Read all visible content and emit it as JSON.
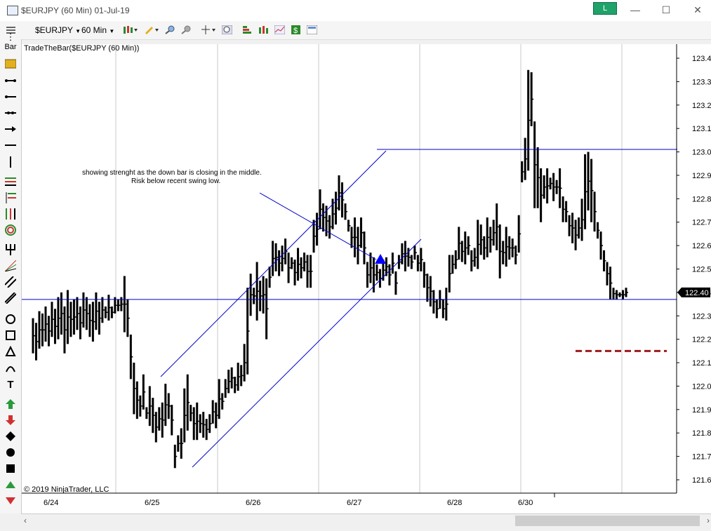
{
  "window": {
    "title": "$EURJPY (60 Min)  01-Jul-19",
    "badge": "L",
    "minimize": "—",
    "maximize": "☐",
    "close": "✕"
  },
  "toolbar": {
    "instrument": "$EURJPY",
    "interval": "60 Min"
  },
  "sidebar": {
    "bar_label": "Bar"
  },
  "chart": {
    "indicator_label": "TradeTheBar($EURJPY (60 Min))",
    "copyright": "© 2019 NinjaTrader, LLC",
    "annotation_line1": "showing strenght as the down bar is closing in the middle.",
    "annotation_line2": "Risk below recent swing low."
  },
  "chart_data": {
    "type": "ohlc",
    "y_ticks": [
      "123.40",
      "123.30",
      "123.20",
      "123.10",
      "123.00",
      "122.90",
      "122.80",
      "122.70",
      "122.60",
      "122.50",
      "122.40",
      "122.30",
      "122.20",
      "122.10",
      "122.00",
      "121.90",
      "121.80",
      "121.70",
      "121.60"
    ],
    "ylim": [
      121.57,
      123.46
    ],
    "x_labels": [
      "6/24",
      "6/25",
      "6/26",
      "6/27",
      "6/28",
      "6/30"
    ],
    "current_price": "122.40",
    "horizontal_lines": [
      122.37,
      123.18
    ],
    "dashed_level": 122.15,
    "colors": {
      "bars": "#000000",
      "lines": "#0000cc",
      "dashed": "#9b1c1c",
      "price_tag": "#000000"
    },
    "bars": [
      [
        122.29,
        122.14
      ],
      [
        122.27,
        122.11
      ],
      [
        122.32,
        122.16
      ],
      [
        122.31,
        122.17
      ],
      [
        122.34,
        122.19
      ],
      [
        122.3,
        122.17
      ],
      [
        122.36,
        122.21
      ],
      [
        122.33,
        122.18
      ],
      [
        122.38,
        122.2
      ],
      [
        122.4,
        122.22
      ],
      [
        122.34,
        122.14
      ],
      [
        122.41,
        122.18
      ],
      [
        122.36,
        122.21
      ],
      [
        122.37,
        122.22
      ],
      [
        122.38,
        122.24
      ],
      [
        122.34,
        122.2
      ],
      [
        122.4,
        122.25
      ],
      [
        122.38,
        122.24
      ],
      [
        122.35,
        122.21
      ],
      [
        122.36,
        122.19
      ],
      [
        122.4,
        122.24
      ],
      [
        122.36,
        122.22
      ],
      [
        122.38,
        122.27
      ],
      [
        122.34,
        122.29
      ],
      [
        122.39,
        122.28
      ],
      [
        122.34,
        122.29
      ],
      [
        122.38,
        122.31
      ],
      [
        122.37,
        122.32
      ],
      [
        122.38,
        122.32
      ],
      [
        122.47,
        122.23
      ],
      [
        122.37,
        122.21
      ],
      [
        122.22,
        122.03
      ],
      [
        122.1,
        121.88
      ],
      [
        122.02,
        121.86
      ],
      [
        121.96,
        121.87
      ],
      [
        122.05,
        121.9
      ],
      [
        121.91,
        121.86
      ],
      [
        122.0,
        121.83
      ],
      [
        121.95,
        121.8
      ],
      [
        121.89,
        121.76
      ],
      [
        121.91,
        121.81
      ],
      [
        121.93,
        121.78
      ],
      [
        122.01,
        121.83
      ],
      [
        121.97,
        121.86
      ],
      [
        121.92,
        121.79
      ],
      [
        121.75,
        121.65
      ],
      [
        121.79,
        121.72
      ],
      [
        121.82,
        121.69
      ],
      [
        121.99,
        121.76
      ],
      [
        122.05,
        121.81
      ],
      [
        121.92,
        121.85
      ],
      [
        121.91,
        121.77
      ],
      [
        121.93,
        121.77
      ],
      [
        121.88,
        121.8
      ],
      [
        121.89,
        121.78
      ],
      [
        121.86,
        121.77
      ],
      [
        121.88,
        121.8
      ],
      [
        121.94,
        121.84
      ],
      [
        121.93,
        121.82
      ],
      [
        122.03,
        121.86
      ],
      [
        121.97,
        121.9
      ],
      [
        122.03,
        121.95
      ],
      [
        122.07,
        121.97
      ],
      [
        122.08,
        121.99
      ],
      [
        122.04,
        121.97
      ],
      [
        122.1,
        121.98
      ],
      [
        122.09,
        122.0
      ],
      [
        122.18,
        122.02
      ],
      [
        122.42,
        122.05
      ],
      [
        122.48,
        122.3
      ],
      [
        122.42,
        122.35
      ],
      [
        122.53,
        122.28
      ],
      [
        122.45,
        122.32
      ],
      [
        122.47,
        122.31
      ],
      [
        122.46,
        122.2
      ],
      [
        122.51,
        122.42
      ],
      [
        122.62,
        122.47
      ],
      [
        122.61,
        122.49
      ],
      [
        122.58,
        122.47
      ],
      [
        122.6,
        122.49
      ],
      [
        122.63,
        122.52
      ],
      [
        122.57,
        122.44
      ],
      [
        122.55,
        122.5
      ],
      [
        122.54,
        122.43
      ],
      [
        122.59,
        122.45
      ],
      [
        122.55,
        122.46
      ],
      [
        122.57,
        122.49
      ],
      [
        122.56,
        122.42
      ],
      [
        122.56,
        122.42
      ],
      [
        122.71,
        122.57
      ],
      [
        122.74,
        122.6
      ],
      [
        122.84,
        122.67
      ],
      [
        122.78,
        122.66
      ],
      [
        122.77,
        122.64
      ],
      [
        122.73,
        122.63
      ],
      [
        122.8,
        122.67
      ],
      [
        122.83,
        122.69
      ],
      [
        122.9,
        122.75
      ],
      [
        122.87,
        122.72
      ],
      [
        122.78,
        122.71
      ],
      [
        122.71,
        122.66
      ],
      [
        122.68,
        122.59
      ],
      [
        122.72,
        122.55
      ],
      [
        122.68,
        122.52
      ],
      [
        122.72,
        122.59
      ],
      [
        122.66,
        122.52
      ],
      [
        122.53,
        122.42
      ],
      [
        122.57,
        122.44
      ],
      [
        122.55,
        122.4
      ],
      [
        122.52,
        122.45
      ],
      [
        122.5,
        122.42
      ],
      [
        122.54,
        122.45
      ],
      [
        122.55,
        122.47
      ],
      [
        122.52,
        122.43
      ],
      [
        122.57,
        122.48
      ],
      [
        122.49,
        122.39
      ],
      [
        122.56,
        122.5
      ],
      [
        122.61,
        122.52
      ],
      [
        122.62,
        122.49
      ],
      [
        122.59,
        122.51
      ],
      [
        122.56,
        122.5
      ],
      [
        122.6,
        122.54
      ],
      [
        122.56,
        122.49
      ],
      [
        122.59,
        122.49
      ],
      [
        122.53,
        122.42
      ],
      [
        122.48,
        122.36
      ],
      [
        122.47,
        122.34
      ],
      [
        122.41,
        122.31
      ],
      [
        122.37,
        122.29
      ],
      [
        122.41,
        122.33
      ],
      [
        122.37,
        122.29
      ],
      [
        122.42,
        122.28
      ],
      [
        122.56,
        122.4
      ],
      [
        122.56,
        122.48
      ],
      [
        122.58,
        122.5
      ],
      [
        122.68,
        122.54
      ],
      [
        122.62,
        122.53
      ],
      [
        122.66,
        122.52
      ],
      [
        122.64,
        122.56
      ],
      [
        122.58,
        122.49
      ],
      [
        122.59,
        122.51
      ],
      [
        122.71,
        122.5
      ],
      [
        122.69,
        122.56
      ],
      [
        122.64,
        122.54
      ],
      [
        122.72,
        122.55
      ],
      [
        122.68,
        122.57
      ],
      [
        122.71,
        122.6
      ],
      [
        122.78,
        122.58
      ],
      [
        122.69,
        122.46
      ],
      [
        122.62,
        122.52
      ],
      [
        122.68,
        122.51
      ],
      [
        122.64,
        122.54
      ],
      [
        122.63,
        122.55
      ],
      [
        122.6,
        122.52
      ],
      [
        122.73,
        122.57
      ],
      [
        122.96,
        122.87
      ],
      [
        123.06,
        122.88
      ],
      [
        123.35,
        122.92
      ],
      [
        123.34,
        123.11
      ],
      [
        123.13,
        122.76
      ],
      [
        123.02,
        122.76
      ],
      [
        122.93,
        122.7
      ],
      [
        122.9,
        122.8
      ],
      [
        122.93,
        122.78
      ],
      [
        122.89,
        122.84
      ],
      [
        122.91,
        122.79
      ],
      [
        122.88,
        122.82
      ],
      [
        122.93,
        122.76
      ],
      [
        122.81,
        122.7
      ],
      [
        122.79,
        122.7
      ],
      [
        122.73,
        122.64
      ],
      [
        122.74,
        122.61
      ],
      [
        122.71,
        122.58
      ],
      [
        122.72,
        122.63
      ],
      [
        122.8,
        122.62
      ],
      [
        122.99,
        122.67
      ],
      [
        123.0,
        122.75
      ],
      [
        122.97,
        122.7
      ],
      [
        122.83,
        122.66
      ],
      [
        122.7,
        122.63
      ],
      [
        122.66,
        122.54
      ],
      [
        122.58,
        122.49
      ],
      [
        122.53,
        122.43
      ],
      [
        122.51,
        122.37
      ],
      [
        122.42,
        122.37
      ],
      [
        122.41,
        122.37
      ],
      [
        122.4,
        122.38
      ],
      [
        122.41,
        122.37
      ],
      [
        122.42,
        122.38
      ]
    ],
    "trendlines": [
      [
        [
          229,
          474
        ],
        [
          550,
          152
        ]
      ],
      [
        [
          274,
          603
        ],
        [
          600,
          278
        ]
      ],
      [
        [
          370,
          212
        ],
        [
          536,
          307
        ]
      ],
      [
        [
          537,
          150
        ],
        [
          965,
          150
        ]
      ]
    ]
  }
}
